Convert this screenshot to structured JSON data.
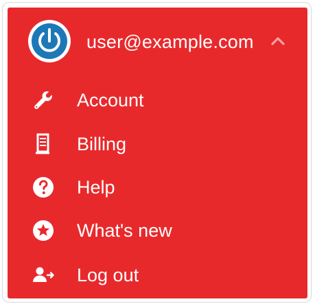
{
  "user": {
    "email": "user@example.com",
    "avatar_icon": "power-icon",
    "toggle_icon": "chevron-up-icon"
  },
  "menu": {
    "items": [
      {
        "label": "Account",
        "icon": "wrench-icon"
      },
      {
        "label": "Billing",
        "icon": "receipt-icon"
      },
      {
        "label": "Help",
        "icon": "question-circle-icon"
      },
      {
        "label": "What's new",
        "icon": "star-circle-icon"
      },
      {
        "label": "Log out",
        "icon": "logout-icon"
      }
    ]
  },
  "colors": {
    "menu_background": "#e8292c",
    "text": "#ffffff",
    "avatar_blue": "#1d78b8"
  }
}
